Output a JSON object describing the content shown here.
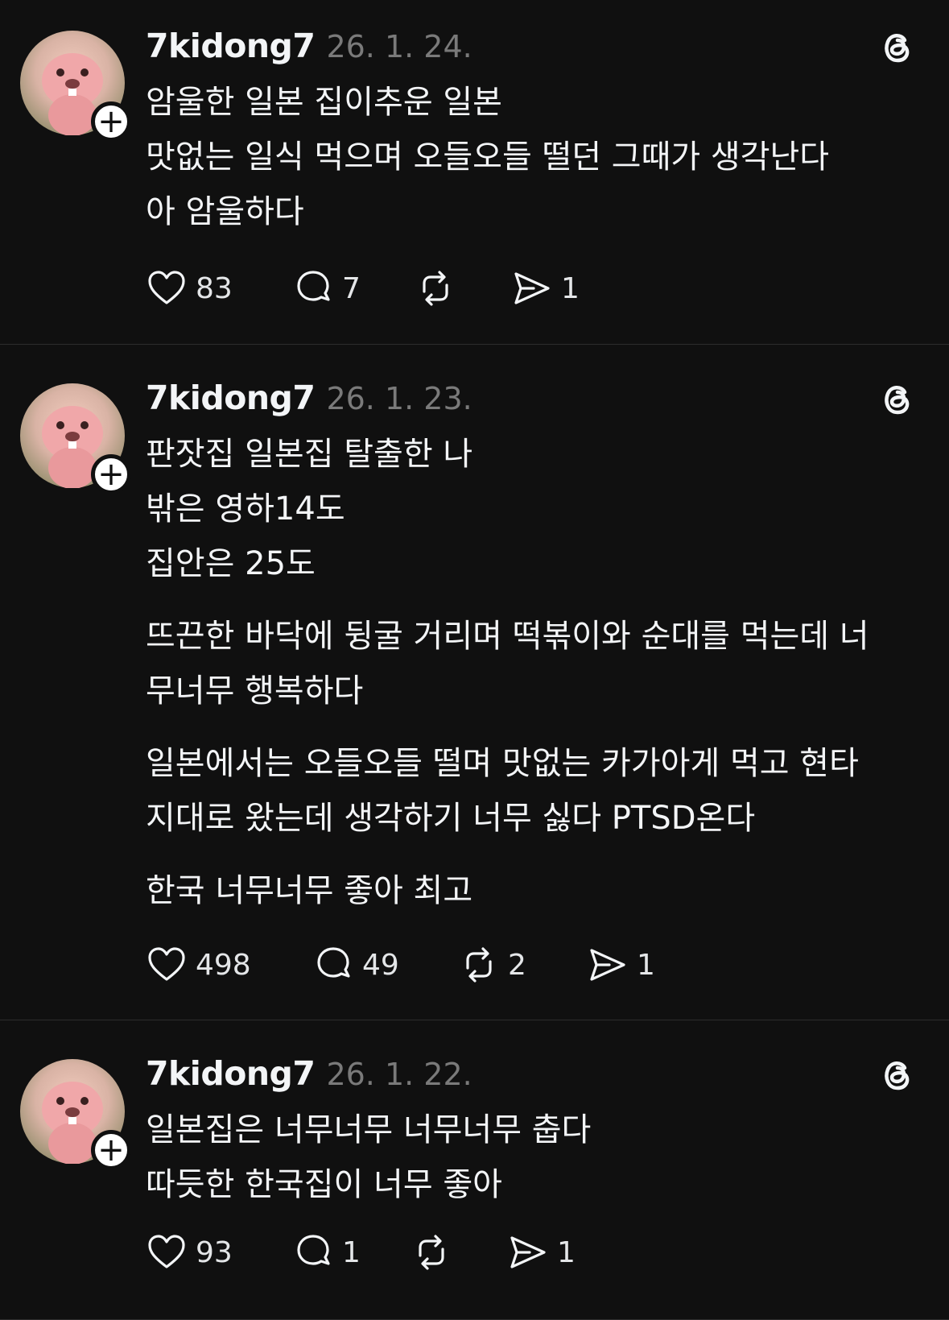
{
  "colors": {
    "background": "#101010",
    "text": "#f3f5f7",
    "muted": "#7a7a7a",
    "divider": "#2d2d2d"
  },
  "icons": {
    "like": "heart-icon",
    "reply": "comment-icon",
    "repost": "repost-icon",
    "share": "send-icon",
    "platform": "threads-logo-icon",
    "follow": "plus-icon"
  },
  "posts": [
    {
      "username": "7kidong7",
      "date": "26. 1. 24.",
      "paragraphs": [
        [
          "암울한 일본 집이추운 일본",
          "맛없는 일식 먹으며 오들오들 떨던 그때가 생각난다",
          "아 암울하다"
        ]
      ],
      "likes": "83",
      "replies": "7",
      "reposts": "",
      "shares": "1"
    },
    {
      "username": "7kidong7",
      "date": "26. 1. 23.",
      "paragraphs": [
        [
          "판잣집 일본집 탈출한 나",
          "밖은 영하14도",
          "집안은 25도"
        ],
        [
          "뜨끈한 바닥에 뒹굴 거리며 떡볶이와 순대를 먹는데 너",
          "무너무 행복하다"
        ],
        [
          "일본에서는 오들오들 떨며 맛없는 카가아게 먹고 현타",
          "지대로 왔는데 생각하기 너무 싫다 PTSD온다"
        ],
        [
          "한국 너무너무 좋아 최고"
        ]
      ],
      "likes": "498",
      "replies": "49",
      "reposts": "2",
      "shares": "1"
    },
    {
      "username": "7kidong7",
      "date": "26. 1. 22.",
      "paragraphs": [
        [
          "일본집은 너무너무 너무너무 춥다",
          "따듯한 한국집이 너무 좋아"
        ]
      ],
      "likes": "93",
      "replies": "1",
      "reposts": "",
      "shares": "1"
    }
  ]
}
